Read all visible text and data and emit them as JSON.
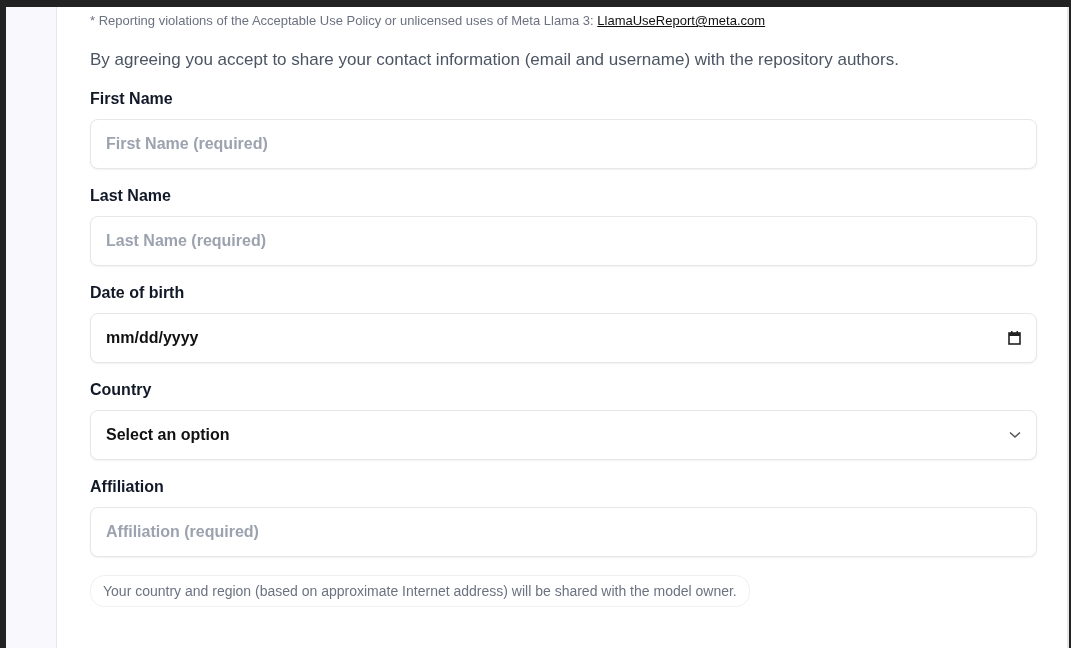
{
  "report_note": {
    "text": "* Reporting violations of the Acceptable Use Policy or unlicensed uses of Meta Llama 3: ",
    "link": "LlamaUseReport@meta.com"
  },
  "consent": "By agreeing you accept to share your contact information (email and username) with the repository authors.",
  "fields": [
    {
      "kind": "text",
      "label": "First Name",
      "placeholder": "First Name (required)"
    },
    {
      "kind": "text",
      "label": "Last Name",
      "placeholder": "Last Name (required)"
    },
    {
      "kind": "date",
      "label": "Date of birth",
      "value": "mm/dd/yyyy"
    },
    {
      "kind": "select",
      "label": "Country",
      "value": "Select an option"
    },
    {
      "kind": "text",
      "label": "Affiliation",
      "placeholder": "Affiliation (required)"
    }
  ],
  "region_note": "Your country and region (based on approximate Internet address) will be shared with the model owner."
}
